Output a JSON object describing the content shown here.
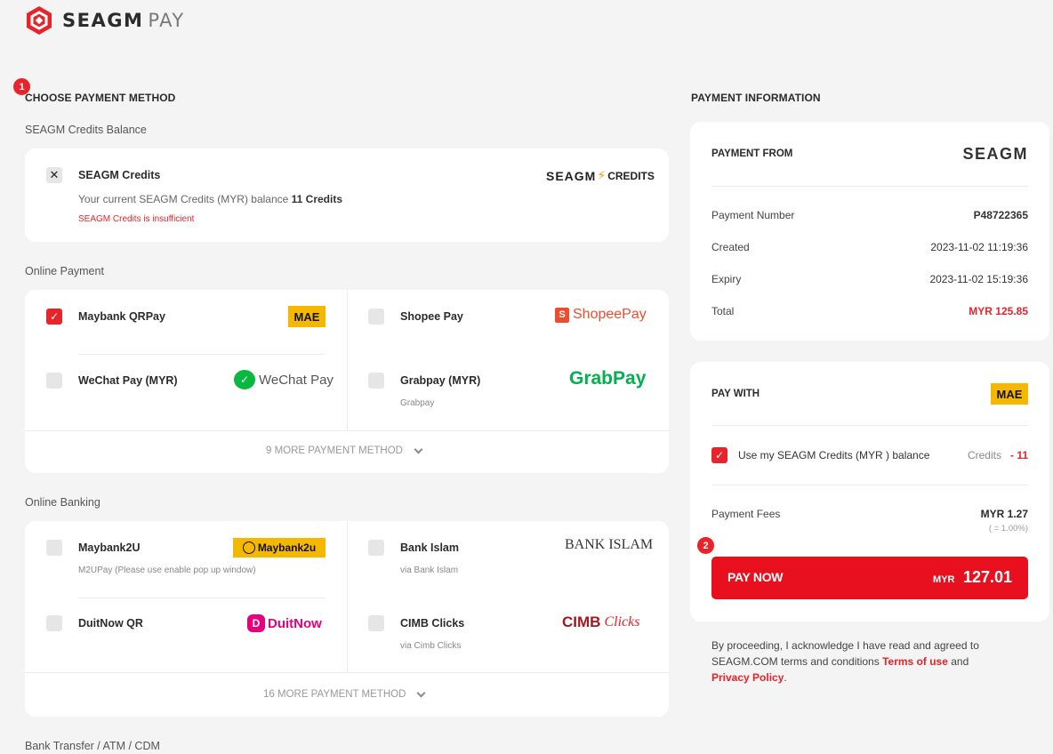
{
  "brand": {
    "name": "SEAGM",
    "suffix": "PAY"
  },
  "steps": {
    "one": "1",
    "two": "2"
  },
  "left": {
    "title": "CHOOSE PAYMENT METHOD",
    "credits_group": "SEAGM Credits Balance",
    "credits": {
      "label": "SEAGM Credits",
      "balance_prefix": "Your current SEAGM Credits (MYR) balance",
      "balance_value": "11 Credits",
      "warning": "SEAGM Credits is insufficient",
      "logo_text": "SEAGM",
      "logo_suffix": "CREDITS"
    },
    "online_group": "Online Payment",
    "online": [
      {
        "label": "Maybank QRPay",
        "logo": "MAE",
        "checked": true
      },
      {
        "label": "Shopee Pay",
        "logo": "ShopeePay",
        "checked": false
      },
      {
        "label": "WeChat Pay (MYR)",
        "logo": "WeChat Pay",
        "checked": false
      },
      {
        "label": "Grabpay (MYR)",
        "sub": "Grabpay",
        "logo": "GrabPay",
        "checked": false
      }
    ],
    "online_more": "9 MORE PAYMENT METHOD",
    "banking_group": "Online Banking",
    "banking": [
      {
        "label": "Maybank2U",
        "sub": "M2UPay (Please use enable pop up window)",
        "logo": "Maybank2u"
      },
      {
        "label": "Bank Islam",
        "sub": "via Bank Islam",
        "logo": "BANK ISLAM"
      },
      {
        "label": "DuitNow QR",
        "logo": "DuitNow"
      },
      {
        "label": "CIMB Clicks",
        "sub": "via Cimb Clicks",
        "logo_a": "CIMB",
        "logo_b": "Clicks"
      }
    ],
    "banking_more": "16 MORE PAYMENT METHOD",
    "transfer_group": "Bank Transfer / ATM / CDM"
  },
  "right": {
    "title": "PAYMENT INFORMATION",
    "payment_from": "PAYMENT FROM",
    "from_logo": "SEAGM",
    "rows": [
      {
        "label": "Payment Number",
        "value": "P48722365"
      },
      {
        "label": "Created",
        "value": "2023-11-02 11:19:36"
      },
      {
        "label": "Expiry",
        "value": "2023-11-02 15:19:36"
      },
      {
        "label": "Total",
        "value": "MYR 125.85"
      }
    ],
    "pay_with": "PAY WITH",
    "pay_with_logo": "MAE",
    "use_credits_label": "Use my SEAGM Credits (MYR ) balance",
    "credits_word": "Credits",
    "credits_amount": "- 11",
    "fees_label": "Payment Fees",
    "fees_value": "MYR 1.27",
    "fees_rate": "( = 1.00%)",
    "pay_button": "PAY NOW",
    "pay_currency": "MYR",
    "pay_amount": "127.01",
    "terms_1": "By proceeding, I acknowledge I have read and agreed to",
    "terms_2": "SEAGM.COM terms and conditions",
    "terms_link_1": "Terms of use",
    "terms_and": "and",
    "terms_link_2": "Privacy Policy",
    "terms_end": "."
  },
  "colors": {
    "accent": "#e8232a",
    "shopee": "#ee4d2d",
    "grab": "#00b14f",
    "wechat": "#09b83e",
    "mae": "#f5b800",
    "cimb": "#a21a1f",
    "duitnow": "#e5007e"
  }
}
